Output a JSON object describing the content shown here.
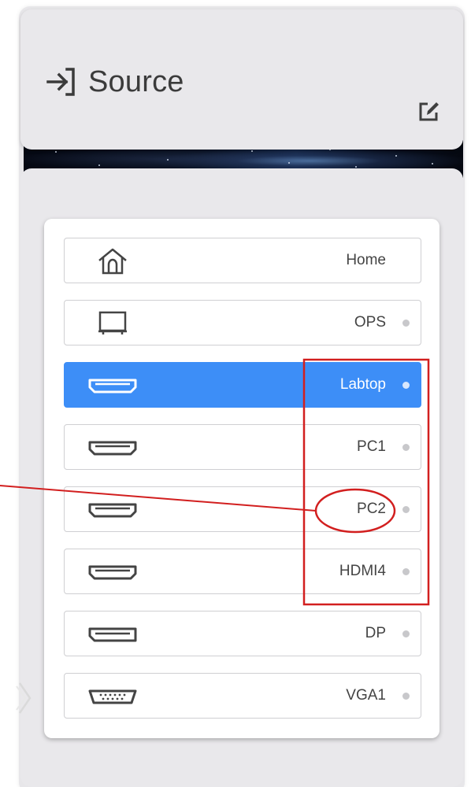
{
  "header": {
    "title": "Source",
    "icons": {
      "source": "input-arrow-icon",
      "edit": "edit-icon"
    }
  },
  "sources": [
    {
      "label": "Home",
      "icon": "home-icon",
      "active": false,
      "has_dot": false
    },
    {
      "label": "OPS",
      "icon": "monitor-icon",
      "active": false,
      "has_dot": true
    },
    {
      "label": "Labtop",
      "icon": "hdmi-icon",
      "active": true,
      "has_dot": true
    },
    {
      "label": "PC1",
      "icon": "hdmi-icon",
      "active": false,
      "has_dot": true
    },
    {
      "label": "PC2",
      "icon": "hdmi-icon",
      "active": false,
      "has_dot": true
    },
    {
      "label": "HDMI4",
      "icon": "hdmi-icon",
      "active": false,
      "has_dot": true
    },
    {
      "label": "DP",
      "icon": "displayport-icon",
      "active": false,
      "has_dot": true
    },
    {
      "label": "VGA1",
      "icon": "vga-icon",
      "active": false,
      "has_dot": true
    }
  ],
  "colors": {
    "accent": "#3d8ef7",
    "annotation": "#d21f1f",
    "panel_bg": "#e9e8eb"
  }
}
